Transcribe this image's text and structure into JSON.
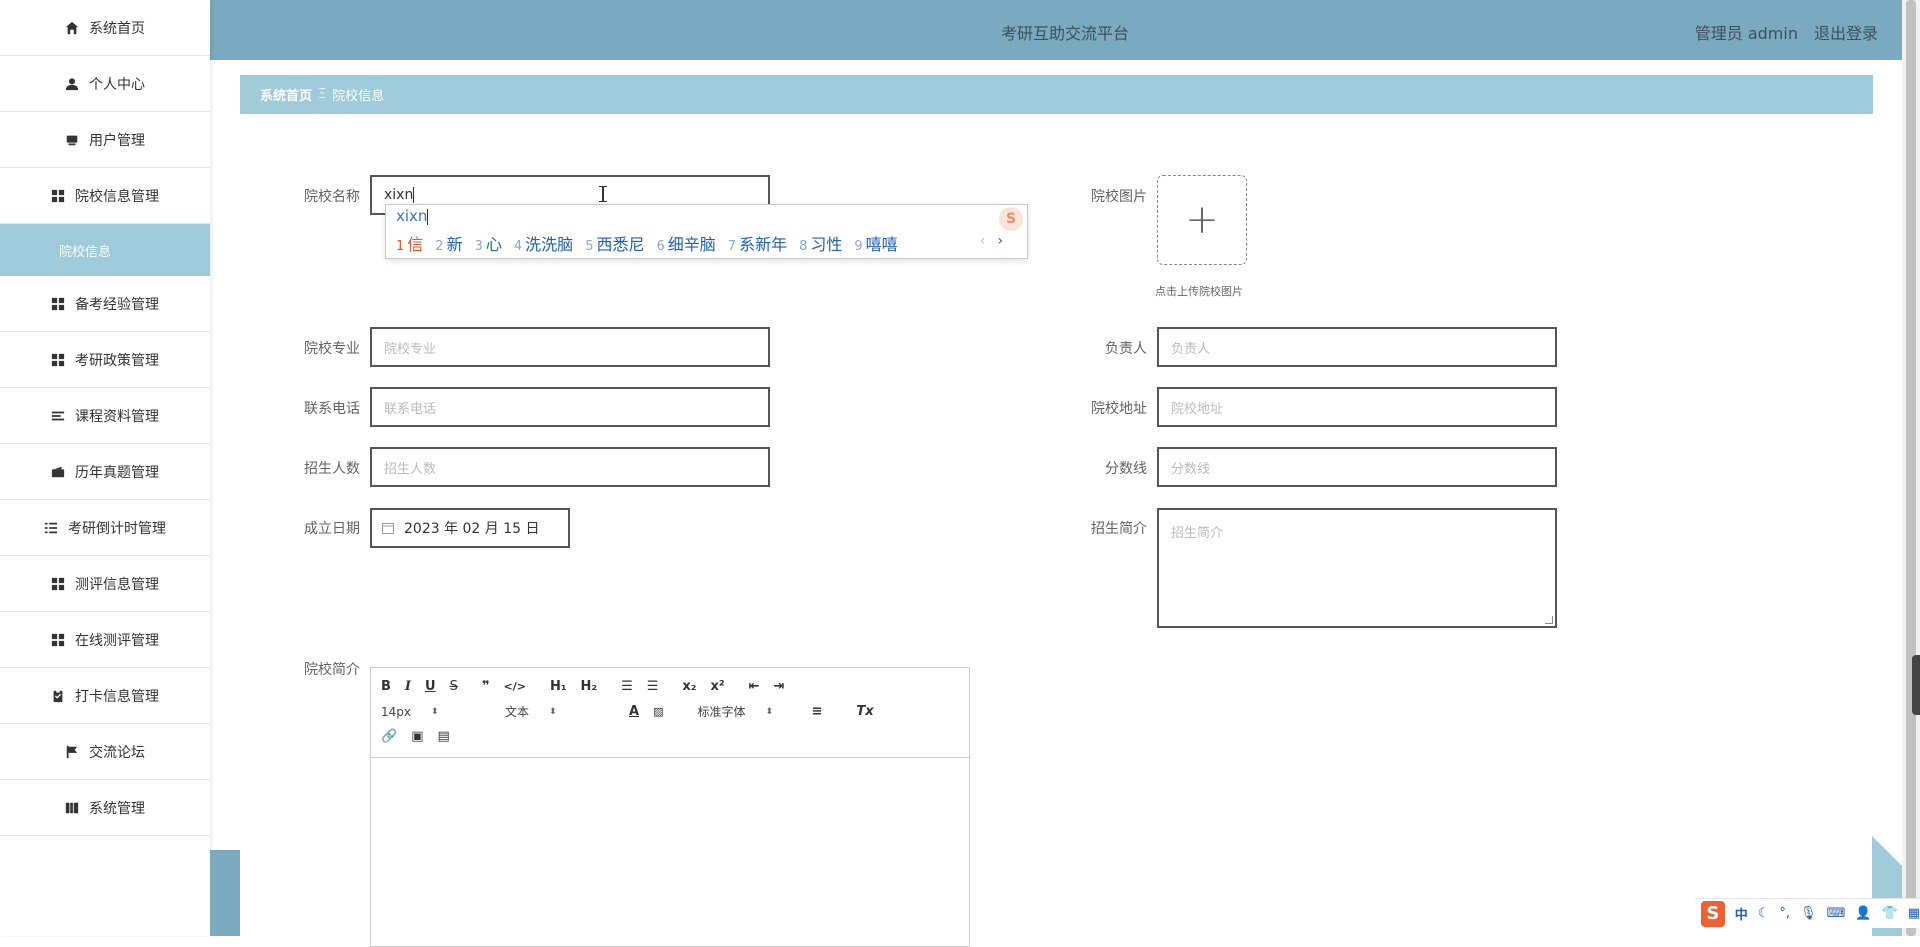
{
  "sidebar": {
    "items": [
      {
        "label": "系统首页",
        "icon": "home-icon"
      },
      {
        "label": "个人中心",
        "icon": "user-icon"
      },
      {
        "label": "用户管理",
        "icon": "users-icon"
      },
      {
        "label": "院校信息管理",
        "icon": "grid-icon"
      },
      {
        "label": "院校信息",
        "icon": ""
      },
      {
        "label": "备考经验管理",
        "icon": "grid-icon"
      },
      {
        "label": "考研政策管理",
        "icon": "grid-icon"
      },
      {
        "label": "课程资料管理",
        "icon": "list-icon"
      },
      {
        "label": "历年真题管理",
        "icon": "wallet-icon"
      },
      {
        "label": "考研倒计时管理",
        "icon": "indent-icon"
      },
      {
        "label": "测评信息管理",
        "icon": "grid-icon"
      },
      {
        "label": "在线测评管理",
        "icon": "grid-icon"
      },
      {
        "label": "打卡信息管理",
        "icon": "clipboard-icon"
      },
      {
        "label": "交流论坛",
        "icon": "flag-icon"
      },
      {
        "label": "系统管理",
        "icon": "book-icon"
      }
    ]
  },
  "header": {
    "title": "考研互助交流平台",
    "user": "管理员 admin",
    "logout": "退出登录"
  },
  "breadcrumb": {
    "home": "系统首页",
    "separator": "Ξ",
    "current": "院校信息"
  },
  "form": {
    "school_name_label": "院校名称",
    "school_name_value": "xixn",
    "school_image_label": "院校图片",
    "upload_tip": "点击上传院校图片",
    "major_label": "院校专业",
    "major_placeholder": "院校专业",
    "manager_label": "负责人",
    "manager_placeholder": "负责人",
    "phone_label": "联系电话",
    "phone_placeholder": "联系电话",
    "address_label": "院校地址",
    "address_placeholder": "院校地址",
    "enroll_label": "招生人数",
    "enroll_placeholder": "招生人数",
    "score_label": "分数线",
    "score_placeholder": "分数线",
    "date_label": "成立日期",
    "date_value": "2023 年 02 月 15 日",
    "intro_label": "招生简介",
    "intro_placeholder": "招生简介",
    "school_intro_label": "院校简介"
  },
  "ime": {
    "pinyin": "xixn",
    "candidates": [
      {
        "n": "1",
        "text": "信"
      },
      {
        "n": "2",
        "text": "新"
      },
      {
        "n": "3",
        "text": "心"
      },
      {
        "n": "4",
        "text": "洗洗脑"
      },
      {
        "n": "5",
        "text": "西悉尼"
      },
      {
        "n": "6",
        "text": "细辛脑"
      },
      {
        "n": "7",
        "text": "系新年"
      },
      {
        "n": "8",
        "text": "习性"
      },
      {
        "n": "9",
        "text": "嘻嘻"
      }
    ]
  },
  "editor": {
    "font_size": "14px",
    "block_type": "文本",
    "font_family": "标准字体"
  },
  "tray": {
    "logo": "S",
    "mode": "中"
  }
}
